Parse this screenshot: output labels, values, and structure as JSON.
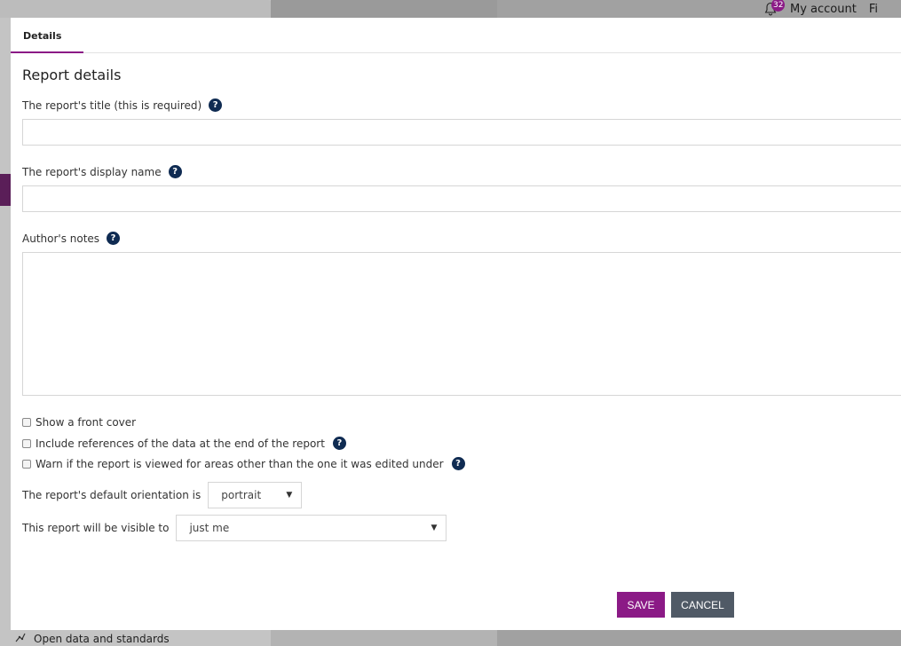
{
  "background": {
    "header": {
      "notification_count": "32",
      "my_account": "My account",
      "truncated_item": "Fi"
    },
    "sidebar_bottom_item": "Open data and standards"
  },
  "modal": {
    "tabs": [
      {
        "label": "Details",
        "active": true
      }
    ],
    "section_title": "Report details",
    "fields": {
      "title": {
        "label": "The report's title (this is required)",
        "value": "",
        "help": "?"
      },
      "display_name": {
        "label": "The report's display name",
        "value": "",
        "help": "?"
      },
      "authors_notes": {
        "label": "Author's notes",
        "value": "",
        "help": "?"
      }
    },
    "checkboxes": [
      {
        "label": "Show a front cover",
        "checked": false,
        "has_help": false
      },
      {
        "label": "Include references of the data at the end of the report",
        "checked": false,
        "has_help": true
      },
      {
        "label": "Warn if the report is viewed for areas other than the one it was edited under",
        "checked": false,
        "has_help": true
      }
    ],
    "orientation": {
      "label": "The report's default orientation is",
      "selected": "portrait"
    },
    "visibility": {
      "label": "This report will be visible to",
      "selected": "just me"
    },
    "buttons": {
      "save": "SAVE",
      "cancel": "CANCEL"
    },
    "help_glyph": "?"
  },
  "colors": {
    "accent": "#8b1a86",
    "cancel": "#505a66",
    "help_icon": "#0f2b52"
  }
}
